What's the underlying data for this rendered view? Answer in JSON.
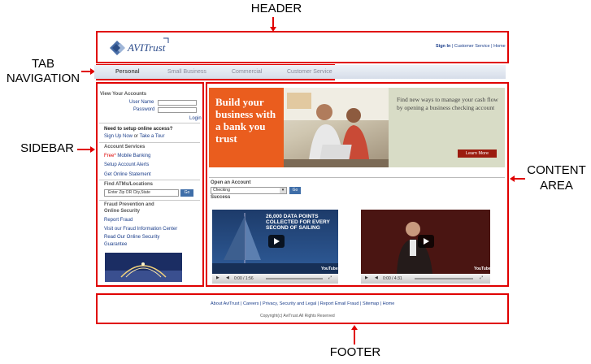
{
  "annotations": {
    "header": "HEADER",
    "tab_navigation_line1": "TAB",
    "tab_navigation_line2": "NAVIGATION",
    "sidebar": "SIDEBAR",
    "content_area_line1": "CONTENT",
    "content_area_line2": "AREA",
    "footer": "FOOTER"
  },
  "header": {
    "logo_text": "AVITrust",
    "sign_in": "Sign In",
    "customer_service": "Customer Service",
    "home": "Home",
    "sep": " | "
  },
  "tabs": [
    "Personal",
    "Small Business",
    "Commercial",
    "Customer Service"
  ],
  "sidebar": {
    "view_accounts": "View Your Accounts",
    "user_name": "User Name",
    "password": "Password",
    "login": "Login",
    "need_access": "Need to setup online access?",
    "signup": "Sign Up Now",
    "or": " or ",
    "tour": "Take a Tour",
    "account_services": "Account Services",
    "free": "Free*",
    "mobile_banking": " Mobile Banking",
    "setup_alerts": "Setup Account Alerts",
    "online_statement": "Get Online Statement",
    "find_atms": "Find ATMs/Locations",
    "zip_placeholder": "Enter Zip OR City,State",
    "go": "Go",
    "fraud_title1": "Fraud Prevention and",
    "fraud_title2": "Online Security",
    "report_fraud": "Report Fraud",
    "fraud_center": "Visit our Fraud Information Center",
    "security_guarantee1": "Read Our Online Security",
    "security_guarantee2": "Guarantee"
  },
  "content": {
    "hero_left": "Build your business with a bank you trust",
    "hero_right": "Find new ways to manage your cash flow by opening a business checking account",
    "learn_more": "Learn More",
    "open_account": "Open an Account",
    "account_type": "Checking",
    "go": "Go",
    "success": "Success",
    "video1": {
      "caption1": "26,000 DATA POINTS",
      "caption2": "COLLECTED FOR EVERY",
      "caption3": "SECOND OF SAILING",
      "time": "0:00 / 1:56",
      "youtube": "YouTube"
    },
    "video2": {
      "time": "0:00 / 4:31",
      "youtube": "YouTube"
    }
  },
  "footer": {
    "links": [
      "About AviTrust",
      "Careers",
      "Privacy, Security and Legal",
      "Report Email Fraud",
      "Sitemap",
      "Home"
    ],
    "copyright": "Copyright(c) AviTrust.All Rights Reserved"
  },
  "colors": {
    "annotation": "#e00000",
    "link": "#1a3d8a",
    "hero_orange": "#ea5d1e",
    "learn_more": "#9b1c0f",
    "go_button": "#3f6ea8"
  }
}
